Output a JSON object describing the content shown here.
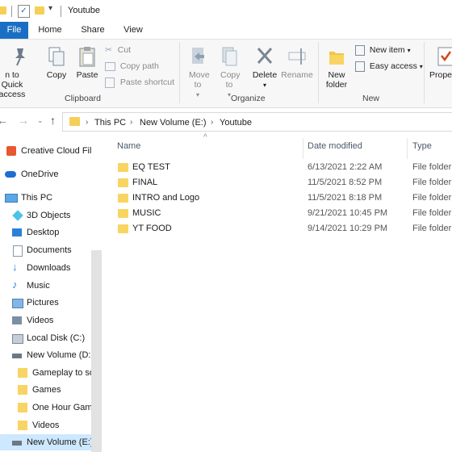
{
  "window": {
    "title": "Youtube"
  },
  "tabs": [
    "File",
    "Home",
    "Share",
    "View"
  ],
  "ribbon": {
    "pin": "n to Quick access",
    "copy": "Copy",
    "paste": "Paste",
    "cut": "Cut",
    "copy_path": "Copy path",
    "paste_shortcut": "Paste shortcut",
    "move_to": "Move to",
    "copy_to": "Copy to",
    "delete": "Delete",
    "rename": "Rename",
    "new_folder": "New folder",
    "new_item": "New item",
    "easy_access": "Easy access",
    "properties": "Proper",
    "group_clipboard": "Clipboard",
    "group_organize": "Organize",
    "group_new": "New"
  },
  "address": {
    "crumbs": [
      "This PC",
      "New Volume (E:)",
      "Youtube"
    ]
  },
  "sidebar": {
    "items": [
      "Creative Cloud Fil",
      "OneDrive",
      "This PC",
      "3D Objects",
      "Desktop",
      "Documents",
      "Downloads",
      "Music",
      "Pictures",
      "Videos",
      "Local Disk (C:)",
      "New Volume (D:",
      "Gameplay to so",
      "Games",
      "One Hour Gam",
      "Videos",
      "New Volume (E:)"
    ]
  },
  "columns": {
    "name": "Name",
    "date": "Date modified",
    "type": "Type"
  },
  "files": [
    {
      "name": "EQ TEST",
      "date": "6/13/2021 2:22 AM",
      "type": "File folder"
    },
    {
      "name": "FINAL",
      "date": "11/5/2021 8:52 PM",
      "type": "File folder"
    },
    {
      "name": "INTRO and Logo",
      "date": "11/5/2021 8:18 PM",
      "type": "File folder"
    },
    {
      "name": "MUSIC",
      "date": "9/21/2021 10:45 PM",
      "type": "File folder"
    },
    {
      "name": "YT FOOD",
      "date": "9/14/2021 10:29 PM",
      "type": "File folder"
    }
  ]
}
